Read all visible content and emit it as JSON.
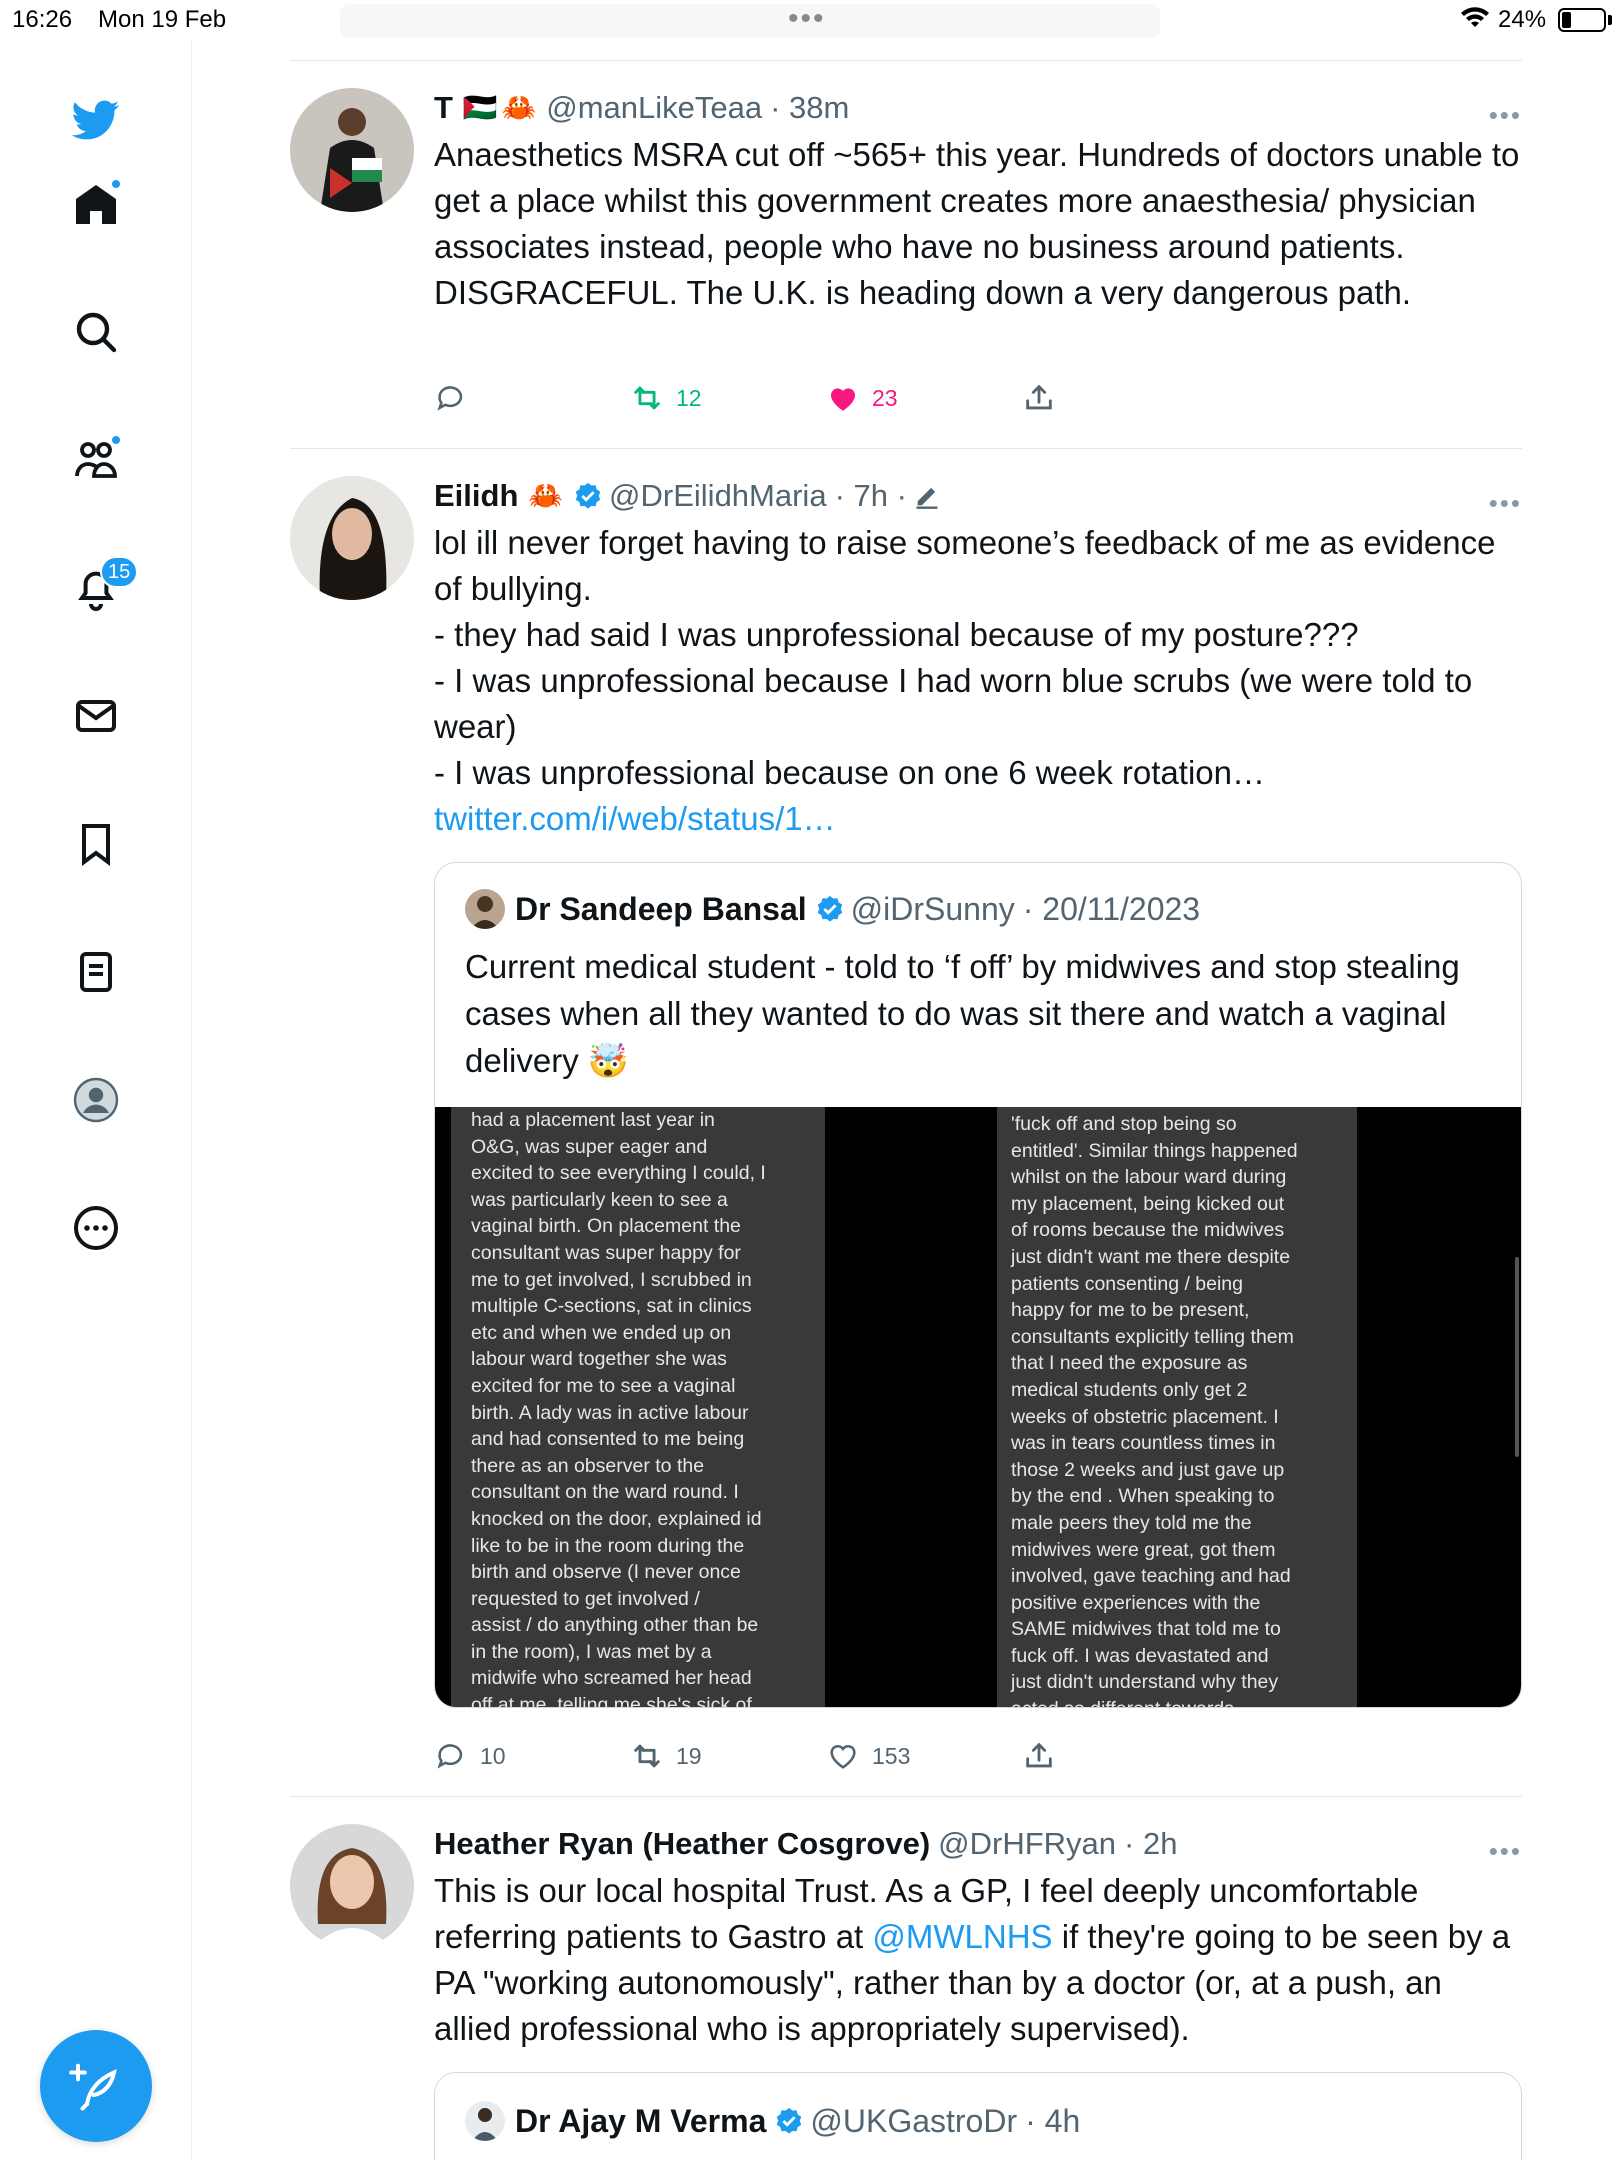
{
  "status_bar": {
    "time": "16:26",
    "date": "Mon 19 Feb",
    "battery": "24%"
  },
  "sidebar": {
    "items": [
      {
        "name": "home",
        "dot": true
      },
      {
        "name": "search"
      },
      {
        "name": "communities",
        "dot": true
      },
      {
        "name": "notifications",
        "badge": "15"
      },
      {
        "name": "messages"
      },
      {
        "name": "bookmarks"
      },
      {
        "name": "lists"
      },
      {
        "name": "profile"
      },
      {
        "name": "more"
      }
    ]
  },
  "tweets": [
    {
      "display_name": "T",
      "handle": "@manLikeTeaa",
      "time": "· 38m",
      "text": "Anaesthetics MSRA cut off ~565+ this year. Hundreds of doctors unable to get a place whilst this government creates more anaesthesia/ physician associates instead, people who have no business around patients. DISGRACEFUL. The U.K. is heading down a very dangerous path.",
      "retweets": "12",
      "likes": "23",
      "colors": {
        "retweet": "#00ba7c",
        "like": "#f91880"
      }
    },
    {
      "display_name": "Eilidh",
      "handle": "@DrEilidhMaria",
      "time": "· 7h ·",
      "text": "lol ill never forget having to raise someone’s feedback of me as evidence of bullying.\n- they had said I was unprofessional because of my posture???\n- I was unprofessional because I had worn blue scrubs (we were told to wear)\n- I was unprofessional because on one 6 week rotation… ",
      "link": "twitter.com/i/web/status/1…",
      "replies": "10",
      "retweets": "19",
      "likes": "153",
      "quote": {
        "display_name": "Dr Sandeep Bansal",
        "handle": "@iDrSunny",
        "date": "· 20/11/2023",
        "text": "Current medical student - told to ‘f off’ by midwives and stop stealing cases when all they wanted to do was sit there and watch a vaginal delivery 🤯",
        "shot_left": "had a placement last year in\nO&G, was super eager and\nexcited to see everything I could, I\nwas particularly keen to see a\nvaginal birth. On placement the\nconsultant was super happy for\nme to get involved, I scrubbed in\nmultiple C-sections, sat in clinics\netc and when we ended up on\nlabour ward together she was\nexcited for me to see a vaginal\nbirth. A lady was in active labour\nand had consented to me being\nthere as an observer to the\nconsultant on the ward round. I\nknocked on the door, explained id\nlike to be in the room during the\nbirth and observe (I never once\nrequested to get involved /\nassist / do anything other than be\nin the room), I was met by a\nmidwife who screamed her head\noff at me, telling me she's sick of",
        "shot_right": "'fuck off and stop being so\nentitled'. Similar things happened\nwhilst on the labour ward during\nmy placement, being kicked out\nof rooms because the midwives\njust didn't want me there despite\npatients consenting / being\nhappy for me to be present,\nconsultants explicitly telling them\nthat I need the exposure as\nmedical students only get 2\nweeks of obstetric placement. I\nwas in tears countless times in\nthose 2 weeks and just gave up\nby the end . When speaking to\nmale peers they told me the\nmidwives were great, got them\ninvolved, gave teaching and had\npositive experiences with the\nSAME midwives that told me to\nfuck off. I was devastated and\njust didn't understand why they\nacted so different towards"
      }
    },
    {
      "display_name": "Heather Ryan (Heather Cosgrove)",
      "handle": "@DrHFRyan",
      "time": "· 2h",
      "text_before": "This is our local hospital Trust. As a GP, I feel deeply uncomfortable referring patients to Gastro at ",
      "mention": "@MWLNHS",
      "text_after": " if they're going to be seen by a PA \"working autonomously\", rather than by a doctor (or, at a push, an allied professional who is appropriately supervised).",
      "quote": {
        "display_name": "Dr Ajay M Verma",
        "handle": "@UKGastroDr",
        "time": "· 4h"
      }
    }
  ]
}
